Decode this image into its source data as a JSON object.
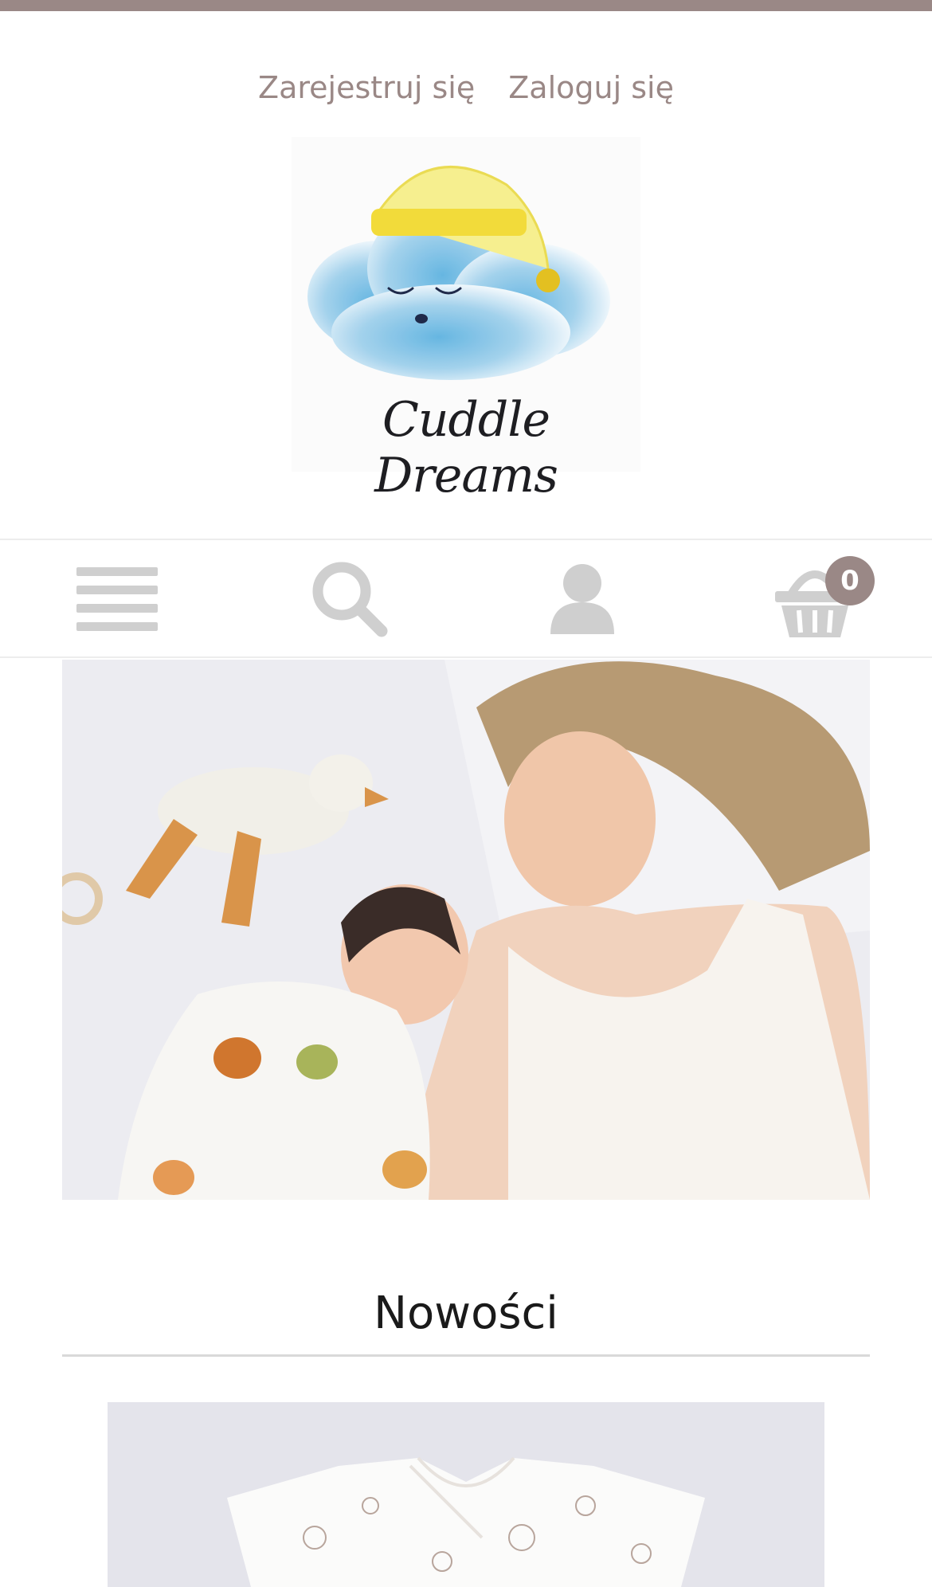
{
  "colors": {
    "accent": "#9a8886",
    "top_strip": "#9a8886",
    "nav_icon": "#cfcfcf",
    "badge_bg": "#9a8886",
    "section_rule": "#d9d9d9"
  },
  "header": {
    "register_label": "Zarejestruj się",
    "login_label": "Zaloguj się",
    "logo_text": "Cuddle Dreams"
  },
  "navbar": {
    "menu_icon": "menu-icon",
    "search_icon": "search-icon",
    "account_icon": "user-icon",
    "cart_icon": "basket-icon",
    "cart_count": "0"
  },
  "main": {
    "hero_image": "mother-and-baby-photo",
    "section_title": "Nowości",
    "first_product_image": "baby-bodysuit-photo"
  }
}
